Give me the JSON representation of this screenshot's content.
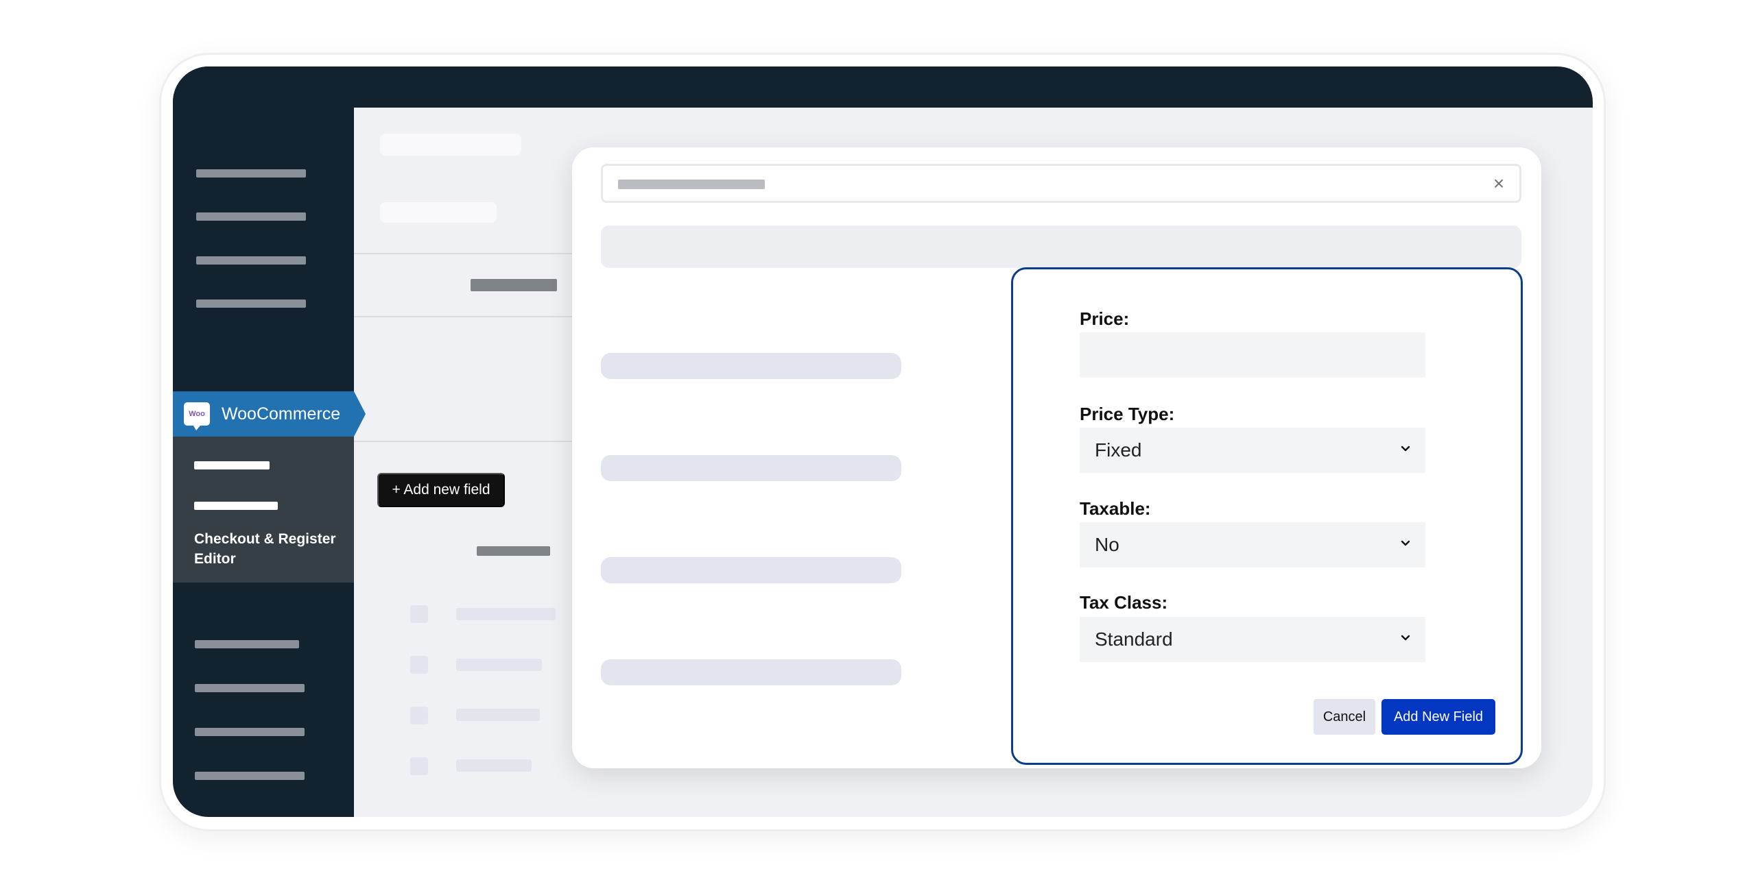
{
  "sidebar": {
    "woo_logo_text": "Woo",
    "woo_label": "WooCommerce",
    "active_submenu": "Checkout & Register Editor"
  },
  "toolbar": {
    "add_new_field_label": "+ Add new field"
  },
  "modal": {
    "close_icon": "×",
    "form": {
      "price_label": "Price:",
      "price_value": "",
      "price_type_label": "Price Type:",
      "price_type_value": "Fixed",
      "taxable_label": "Taxable:",
      "taxable_value": "No",
      "tax_class_label": "Tax Class:",
      "tax_class_value": "Standard",
      "cancel_label": "Cancel",
      "submit_label": "Add New Field"
    }
  },
  "colors": {
    "sidebar_bg": "#13222f",
    "woo_accent": "#2271b1",
    "submenu_bg": "#353f45",
    "form_border": "#0b3e8a",
    "primary_button": "#0336c1"
  }
}
